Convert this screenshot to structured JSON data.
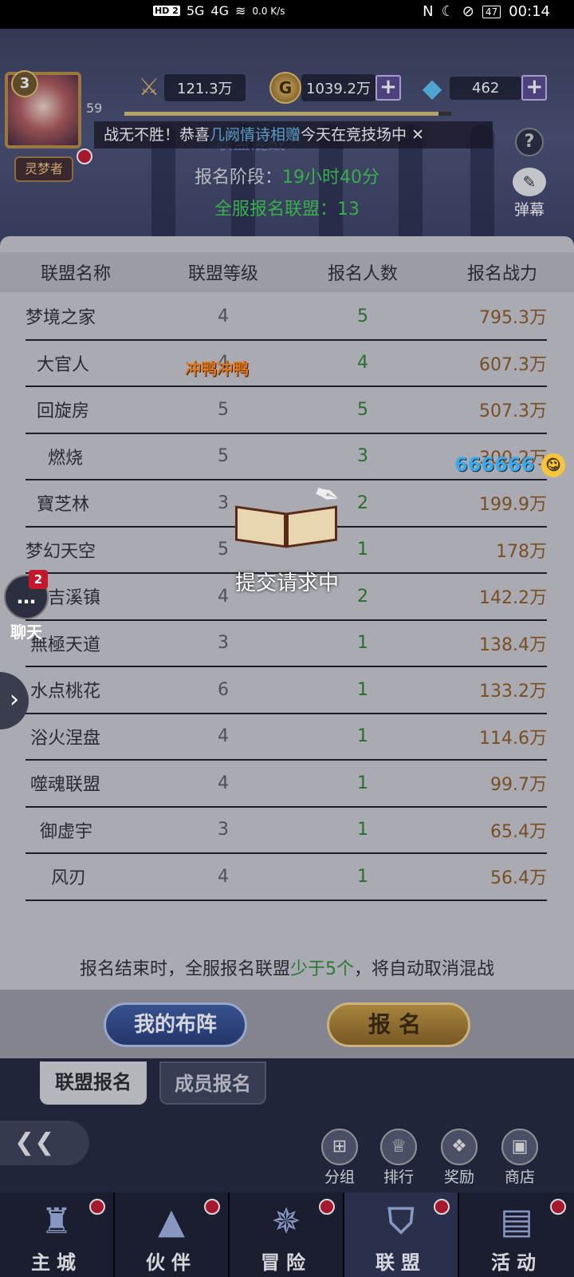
{
  "status_bar": {
    "network_left": "HD 2",
    "signal_1": "5G",
    "signal_2": "4G",
    "speed": "0.0 K/s",
    "battery": "47",
    "time": "00:14"
  },
  "header": {
    "player_level_badge": "3",
    "player_level": "59",
    "player_title": "灵梦者",
    "combat_power": "121.3万",
    "gold": "1039.2万",
    "diamonds": "462",
    "exp_fraction": 0.96,
    "marquee_prefix": "战无不胜！恭喜",
    "marquee_highlight": "几阙情诗相赠",
    "marquee_suffix": "今天在竞技场中",
    "faint_title": "联盟混战",
    "stage_label": "报名阶段：",
    "stage_time": "19小时40分",
    "server_signup_label": "全服报名联盟：",
    "server_signup_count": "13",
    "help_label": "?",
    "danmu_label": "弹幕"
  },
  "table": {
    "headers": [
      "联盟名称",
      "联盟等级",
      "报名人数",
      "报名战力"
    ],
    "rows": [
      {
        "name": "梦境之家",
        "level": "4",
        "count": "5",
        "power": "795.3万"
      },
      {
        "name": "大官人",
        "level": "4",
        "count": "4",
        "power": "607.3万"
      },
      {
        "name": "回旋房",
        "level": "5",
        "count": "5",
        "power": "507.3万"
      },
      {
        "name": "燃烧",
        "level": "5",
        "count": "3",
        "power": "300.2万"
      },
      {
        "name": "寶芝林",
        "level": "3",
        "count": "2",
        "power": "199.9万"
      },
      {
        "name": "梦幻天空",
        "level": "5",
        "count": "1",
        "power": "178万"
      },
      {
        "name": "吉溪镇",
        "level": "4",
        "count": "2",
        "power": "142.2万"
      },
      {
        "name": "無極天道",
        "level": "3",
        "count": "1",
        "power": "138.4万"
      },
      {
        "name": "水点桃花",
        "level": "6",
        "count": "1",
        "power": "133.2万"
      },
      {
        "name": "浴火涅盘",
        "level": "4",
        "count": "1",
        "power": "114.6万"
      },
      {
        "name": "噬魂联盟",
        "level": "4",
        "count": "1",
        "power": "99.7万"
      },
      {
        "name": "御虚宇",
        "level": "3",
        "count": "1",
        "power": "65.4万"
      },
      {
        "name": "风刃",
        "level": "4",
        "count": "1",
        "power": "56.4万"
      }
    ]
  },
  "footnote": {
    "prefix": "报名结束时，全服报名联盟",
    "highlight": "少于5个",
    "suffix": "，将自动取消混战"
  },
  "buttons": {
    "my_layout": "我的布阵",
    "sign_up": "报名"
  },
  "tabs": {
    "alliance_signup": "联盟报名",
    "member_signup": "成员报名"
  },
  "mini_buttons": [
    "分组",
    "排行",
    "奖励",
    "商店"
  ],
  "nav": [
    "主城",
    "伙伴",
    "冒险",
    "联盟",
    "活动"
  ],
  "overlays": {
    "loading_text": "提交请求中",
    "danmu_1": "冲鸭冲鸭",
    "danmu_2": "666666",
    "chat_label": "聊天",
    "chat_badge": "2"
  }
}
